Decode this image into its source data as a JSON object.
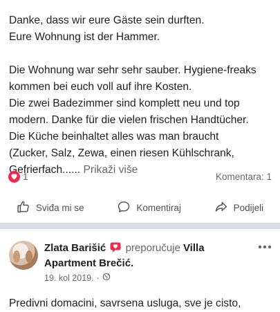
{
  "review1": {
    "paragraph1": [
      "Danke, dass wir eure Gäste sein durften.",
      "Eure Wohnung ist der Hammer."
    ],
    "paragraph2": [
      "Die Wohnung war sehr sehr sauber. Hygiene-freaks",
      "kommen bei euch voll auf ihre Kosten.",
      "Die zwei Badezimmer sind komplett neu und top",
      "modern. Danke für die vielen frischen Handtücher.",
      "Die Küche beinhaltet alles was man braucht",
      "(Zucker, Salz, Zewa, einen riesen Kühlschrank,",
      "Gefrierfach......"
    ],
    "see_more": "Prikaži više",
    "reaction_count": "1",
    "comments": "Komentara: 1",
    "reaction_icon": "heart-icon"
  },
  "actions": {
    "like": "Sviđa mi se",
    "comment": "Komentiraj",
    "share": "Podijeli"
  },
  "review2": {
    "author": "Zlata Barišić",
    "recommend_word": "preporučuje",
    "page_name": "Villa Apartment Brečić.",
    "date": "19. kol 2019.",
    "separator": "·",
    "audience_icon": "globe-icon",
    "text": "Predivni domacini, savrsena usluga, sve je cisto,"
  },
  "colors": {
    "heart": "#f0284a",
    "separator": "#dadde1",
    "muted": "#65676b"
  }
}
